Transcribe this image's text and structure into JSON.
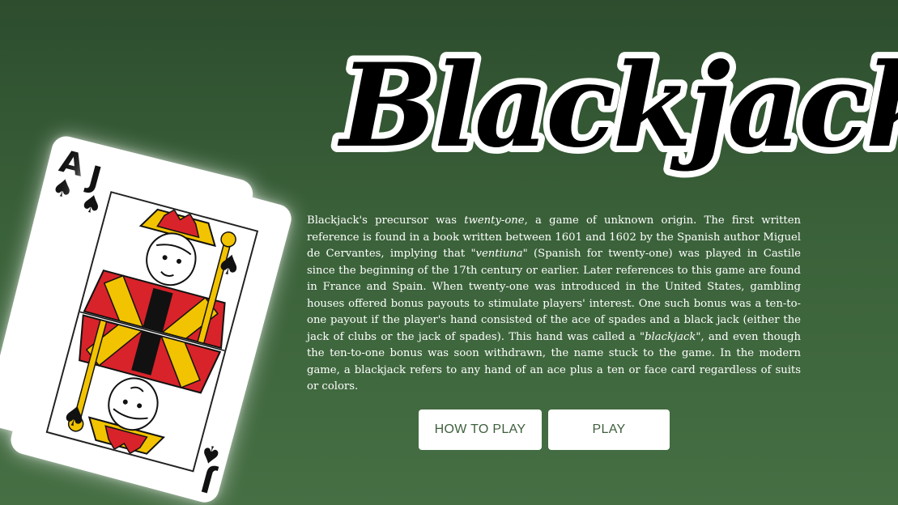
{
  "title": "Blackjack",
  "cards": {
    "back_card": {
      "rank": "A",
      "suit": "♠"
    },
    "front_card": {
      "rank": "J",
      "suit": "♠"
    }
  },
  "description": {
    "p1": "Blackjack's precursor was ",
    "em1": "twenty-one",
    "p2": ", a game of unknown origin. The first written reference is found in a book written between 1601 and 1602 by the Spanish author Miguel de Cervantes, implying that ",
    "em2": "\"ventiuna\"",
    "p3": " (Spanish for twenty-one) was played in Castile since the beginning of the 17th century or earlier. Later references to this game are found in France and Spain. When twenty-one was introduced in the United States, gambling houses offered bonus payouts to stimulate players' interest. One such bonus was a ten-to-one payout if the player's hand consisted of the ace of spades and a black jack (either the jack of clubs or the jack of spades). This hand was called a ",
    "em3": "\"blackjack\"",
    "p4": ", and even though the ten-to-one bonus was soon withdrawn, the name stuck to the game. In the modern game, a blackjack refers to any hand of an ace plus a ten or face card regardless of suits or colors."
  },
  "buttons": {
    "how_to_play": "HOW TO PLAY",
    "play": "PLAY"
  },
  "colors": {
    "background_top": "#2d4d2e",
    "background_bottom": "#466f44",
    "button_text": "#3e5f3c",
    "card_red": "#d8232a",
    "card_yellow": "#f2c300"
  }
}
